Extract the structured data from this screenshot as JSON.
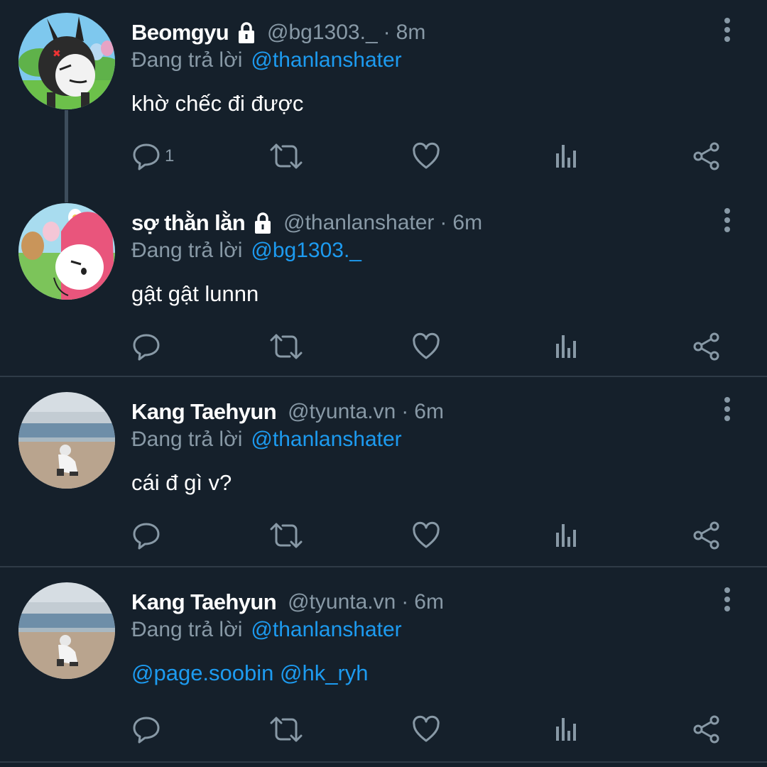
{
  "tweets": [
    {
      "name": "Beomgyu",
      "locked": true,
      "handle": "@bg1303._",
      "separator": "·",
      "time": "8m",
      "reply_prefix": "Đang trả lời",
      "reply_to": "@thanlanshater",
      "text": "khờ chếc đi được",
      "reply_count": "1",
      "avatar": "cartoon-avatar-black-bunny"
    },
    {
      "name": "sợ thằn lằn",
      "locked": true,
      "handle": "@thanlanshater",
      "separator": "·",
      "time": "6m",
      "reply_prefix": "Đang trả lời",
      "reply_to": "@bg1303._",
      "text": "gật gật lunnn",
      "reply_count": "",
      "avatar": "cartoon-avatar-pink-bunny"
    },
    {
      "name": "Kang Taehyun",
      "locked": false,
      "handle": "@tyunta.vn",
      "separator": "·",
      "time": "6m",
      "reply_prefix": "Đang trả lời",
      "reply_to": "@thanlanshater",
      "text": "cái đ gì v?",
      "reply_count": "",
      "avatar": "photo-avatar-beach"
    },
    {
      "name": "Kang Taehyun",
      "locked": false,
      "handle": "@tyunta.vn",
      "separator": "·",
      "time": "6m",
      "reply_prefix": "Đang trả lời",
      "reply_to": "@thanlanshater",
      "mentions": [
        "@page.soobin",
        "@hk_ryh"
      ],
      "reply_count": "",
      "avatar": "photo-avatar-beach"
    }
  ],
  "colors": {
    "background": "#15202b",
    "secondary_text": "#8899a6",
    "link": "#1d9bf0",
    "divider": "#2f3b47"
  },
  "icons": [
    "reply-icon",
    "retweet-icon",
    "like-icon",
    "analytics-icon",
    "share-icon",
    "more-icon",
    "lock-icon"
  ]
}
